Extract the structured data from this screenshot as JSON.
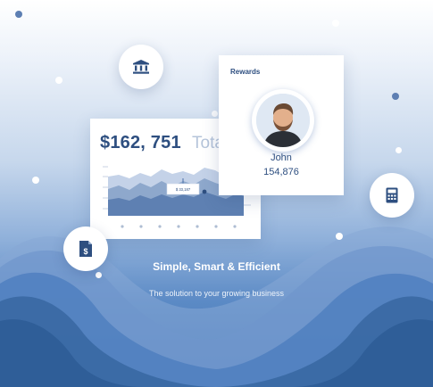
{
  "rewards_card": {
    "title": "Rewards",
    "user_name": "John",
    "points": "154,876"
  },
  "total_card": {
    "amount": "$162, 751",
    "label": "Total",
    "chart_tooltip": "$ 33,187"
  },
  "hero": {
    "headline": "Simple, Smart & Efficient",
    "subheadline": "The solution to your growing business"
  },
  "icons": {
    "bank": "bank-icon",
    "calculator": "calculator-icon",
    "invoice": "invoice-dollar-icon"
  },
  "colors": {
    "brand_dark": "#2e4f80",
    "accent": "#3e72b4"
  }
}
